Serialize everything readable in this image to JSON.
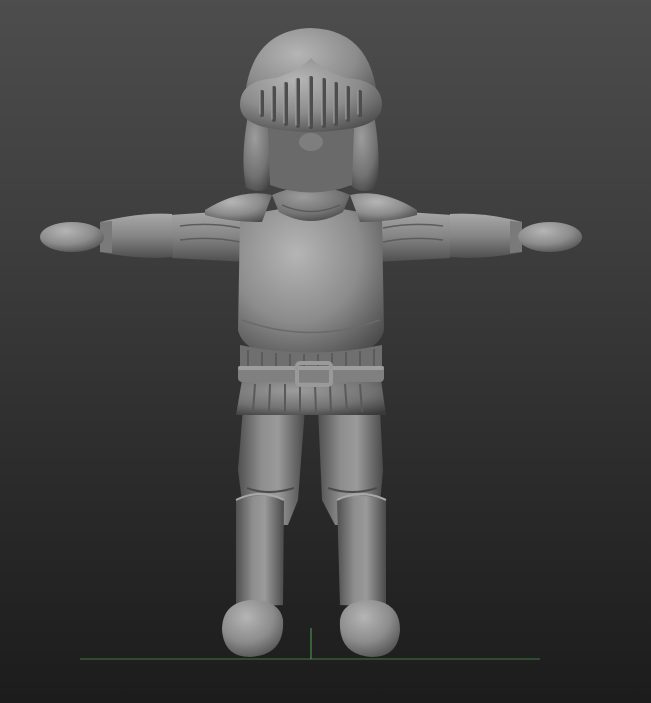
{
  "viewport": {
    "background_top": "#4d4d4d",
    "background_bottom": "#1c1c1c",
    "ground_line_color": "#3f7a3f",
    "axis_line_color": "#55a055"
  },
  "model": {
    "subject": "knight",
    "parts": [
      "helmet",
      "visor",
      "shoulder-pauldrons",
      "breastplate",
      "belt",
      "buckle",
      "tunic-skirt",
      "arms",
      "hands",
      "legs",
      "boots"
    ],
    "material_base": "#8c8c8c",
    "material_highlight": "#b5b5b5",
    "material_shadow": "#404040"
  }
}
